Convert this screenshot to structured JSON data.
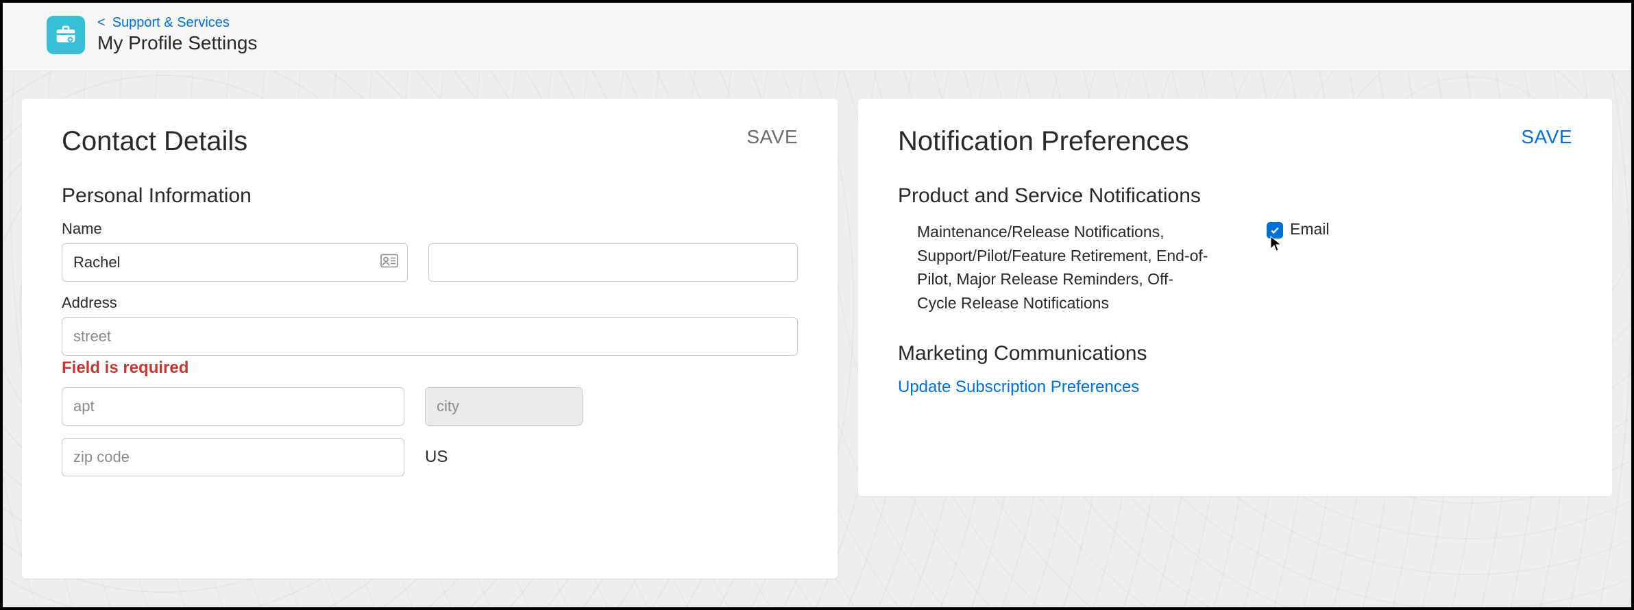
{
  "header": {
    "breadcrumb_label": "Support & Services",
    "page_title": "My Profile Settings"
  },
  "contact": {
    "card_title": "Contact Details",
    "save_label": "SAVE",
    "section_personal": "Personal Information",
    "name_label": "Name",
    "first_name_value": "Rachel",
    "last_name_value": "",
    "address_label": "Address",
    "street_placeholder": "street",
    "street_value": "",
    "street_error": "Field is required",
    "apt_placeholder": "apt",
    "apt_value": "",
    "city_placeholder": "city",
    "city_value": "",
    "zip_placeholder": "zip code",
    "zip_value": "",
    "country": "US"
  },
  "notifications": {
    "card_title": "Notification Preferences",
    "save_label": "SAVE",
    "section_product": "Product and Service Notifications",
    "product_desc": "Maintenance/Release Notifications, Support/Pilot/Feature Retirement, End-of-Pilot, Major Release Reminders, Off-Cycle Release Notifications",
    "email_label": "Email",
    "email_checked": true,
    "section_marketing": "Marketing Communications",
    "marketing_link": "Update Subscription Preferences"
  }
}
